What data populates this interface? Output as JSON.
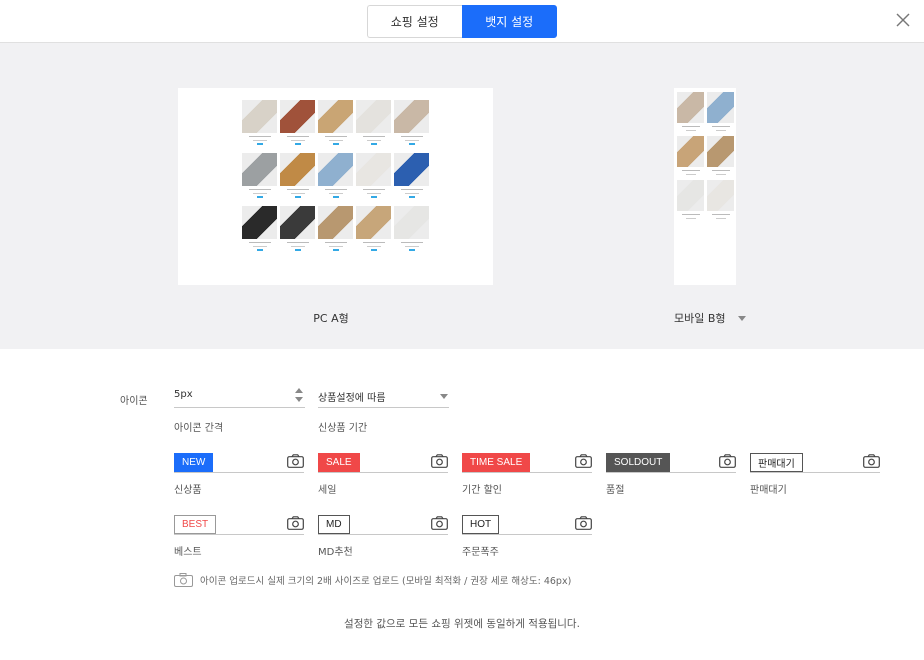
{
  "tabs": [
    {
      "label": "쇼핑 설정",
      "active": false
    },
    {
      "label": "뱃지 설정",
      "active": true
    }
  ],
  "close_icon": "close-icon",
  "preview": {
    "pc_label": "PC A형",
    "mobile_label": "모바일 B형"
  },
  "icon_settings": {
    "row_label": "아이콘",
    "spacing": {
      "value": "5px",
      "caption": "아이콘 간격"
    },
    "period": {
      "value": "상품설정에 따름",
      "caption": "신상품 기간"
    },
    "badges": [
      {
        "text": "NEW",
        "caption": "신상품",
        "bg": "#1b6dfa",
        "fg": "#ffffff",
        "border": "#1b6dfa"
      },
      {
        "text": "SALE",
        "caption": "세일",
        "bg": "#f04848",
        "fg": "#ffffff",
        "border": "#f04848"
      },
      {
        "text": "TIME SALE",
        "caption": "기간 할인",
        "bg": "#f04848",
        "fg": "#ffffff",
        "border": "#f04848"
      },
      {
        "text": "SOLDOUT",
        "caption": "품절",
        "bg": "#555555",
        "fg": "#ffffff",
        "border": "#555555"
      },
      {
        "text": "판매대기",
        "caption": "판매대기",
        "bg": "#ffffff",
        "fg": "#222222",
        "border": "#555555"
      },
      {
        "text": "BEST",
        "caption": "베스트",
        "bg": "#ffffff",
        "fg": "#f04848",
        "border": "#999999"
      },
      {
        "text": "MD",
        "caption": "MD추천",
        "bg": "#ffffff",
        "fg": "#222222",
        "border": "#555555"
      },
      {
        "text": "HOT",
        "caption": "주문폭주",
        "bg": "#ffffff",
        "fg": "#222222",
        "border": "#555555"
      }
    ],
    "upload_note": "아이콘 업로드시 실제 크기의 2배 사이즈로 업로드 (모바일 최적화 / 권장 세로 해상도: 46px)"
  },
  "footer_message": "설정한 값으로 모든 쇼핑 위젯에 동일하게 적용됩니다."
}
